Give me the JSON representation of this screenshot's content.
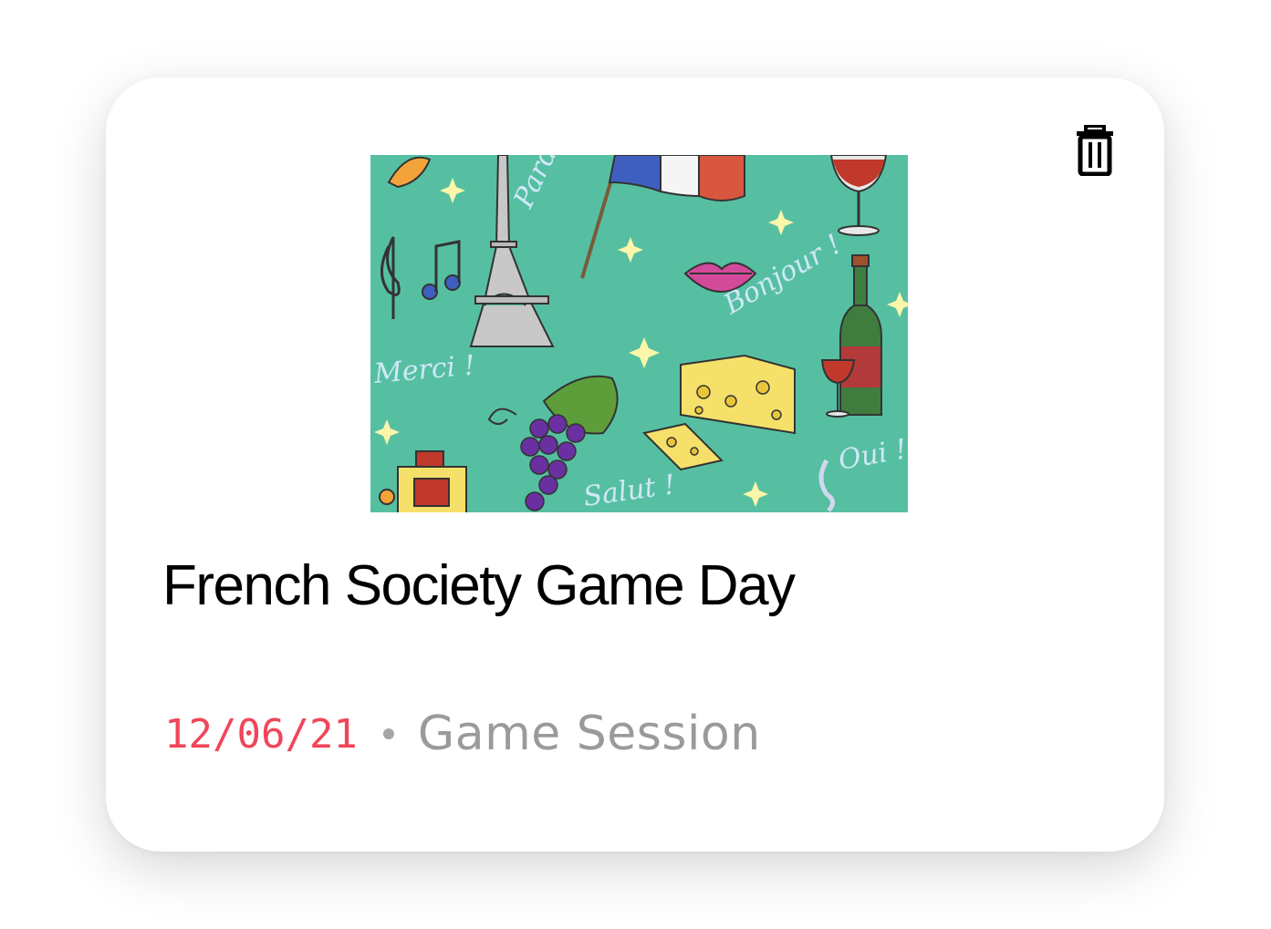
{
  "event": {
    "title": "French Society Game Day",
    "date": "12/06/21",
    "type": "Game Session",
    "thumbnail_alt": "French themed illustration",
    "thumbnail_words": {
      "pardon": "Pardon",
      "bonjour": "Bonjour !",
      "merci": "Merci !",
      "salut": "Salut !",
      "oui": "Oui !"
    }
  },
  "actions": {
    "delete_icon": "trash-icon"
  },
  "colors": {
    "date": "#f0465a",
    "type": "#9a9a9a",
    "separator": "#a6a6a6",
    "thumbnail_bg": "#56bfa2"
  }
}
